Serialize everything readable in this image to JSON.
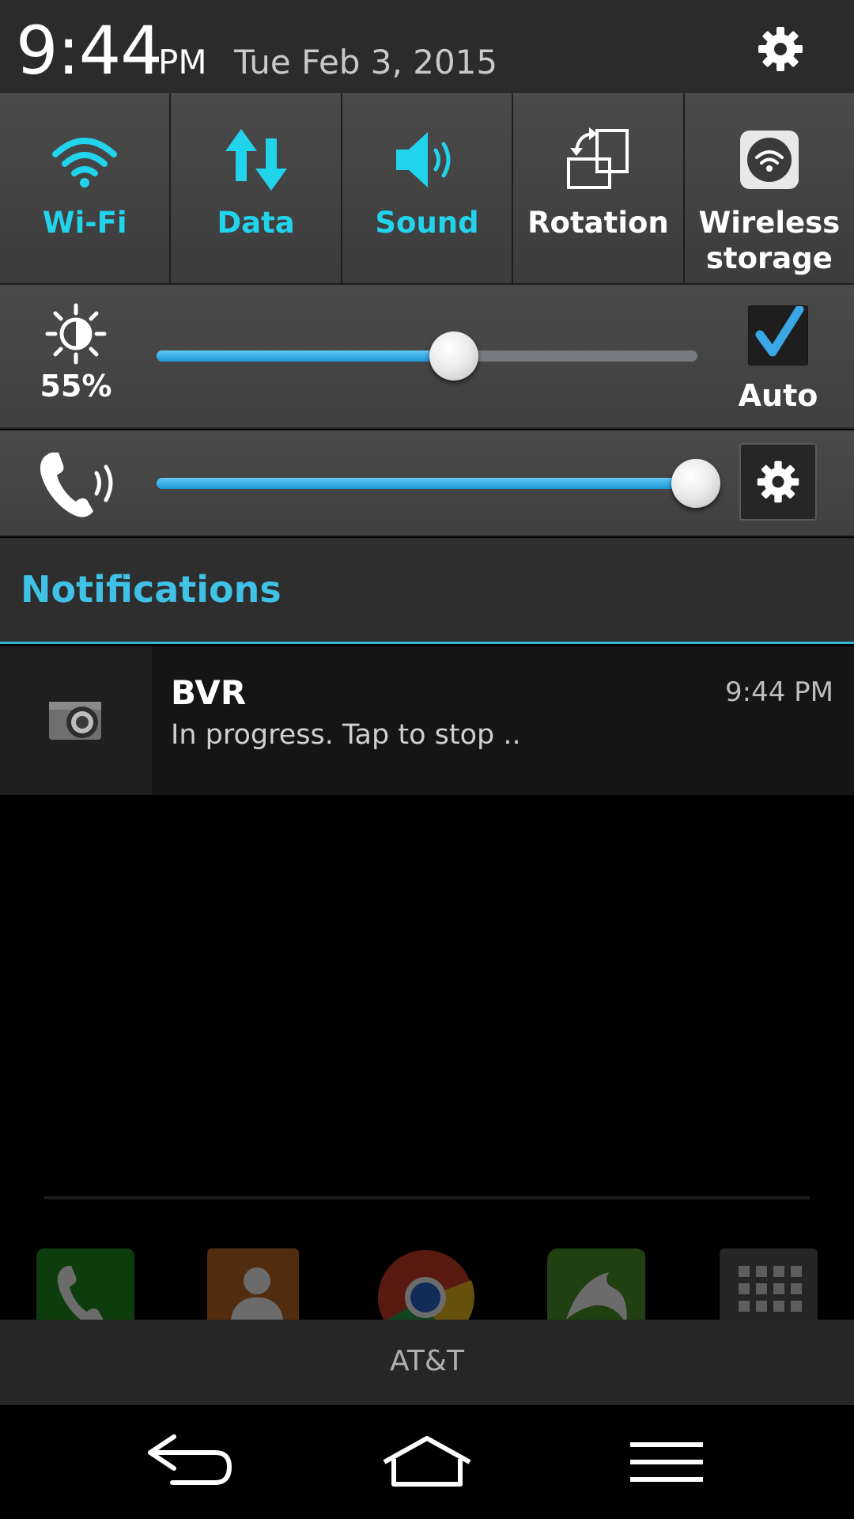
{
  "status": {
    "time": "9:44",
    "ampm": "PM",
    "date": "Tue Feb 3, 2015"
  },
  "toggles": [
    {
      "label": "Wi-Fi",
      "icon": "wifi-icon",
      "on": true
    },
    {
      "label": "Data",
      "icon": "data-arrows-icon",
      "on": true
    },
    {
      "label": "Sound",
      "icon": "speaker-icon",
      "on": true
    },
    {
      "label": "Rotation",
      "icon": "rotation-icon",
      "on": false
    },
    {
      "label": "Wireless\nstorage",
      "icon": "wireless-storage-icon",
      "on": false
    }
  ],
  "brightness": {
    "percent_label": "55%",
    "level": 0.55,
    "auto_label": "Auto",
    "auto_checked": true
  },
  "volume": {
    "level": 1.0
  },
  "notifications": {
    "title": "Notifications",
    "items": [
      {
        "app": "BVR",
        "time": "9:44 PM",
        "text": "In progress. Tap to stop .."
      }
    ]
  },
  "carrier": "AT&T",
  "colors": {
    "accent": "#22d3ec",
    "slider": "#1f97d8",
    "header_text": "#3fc2e6"
  }
}
